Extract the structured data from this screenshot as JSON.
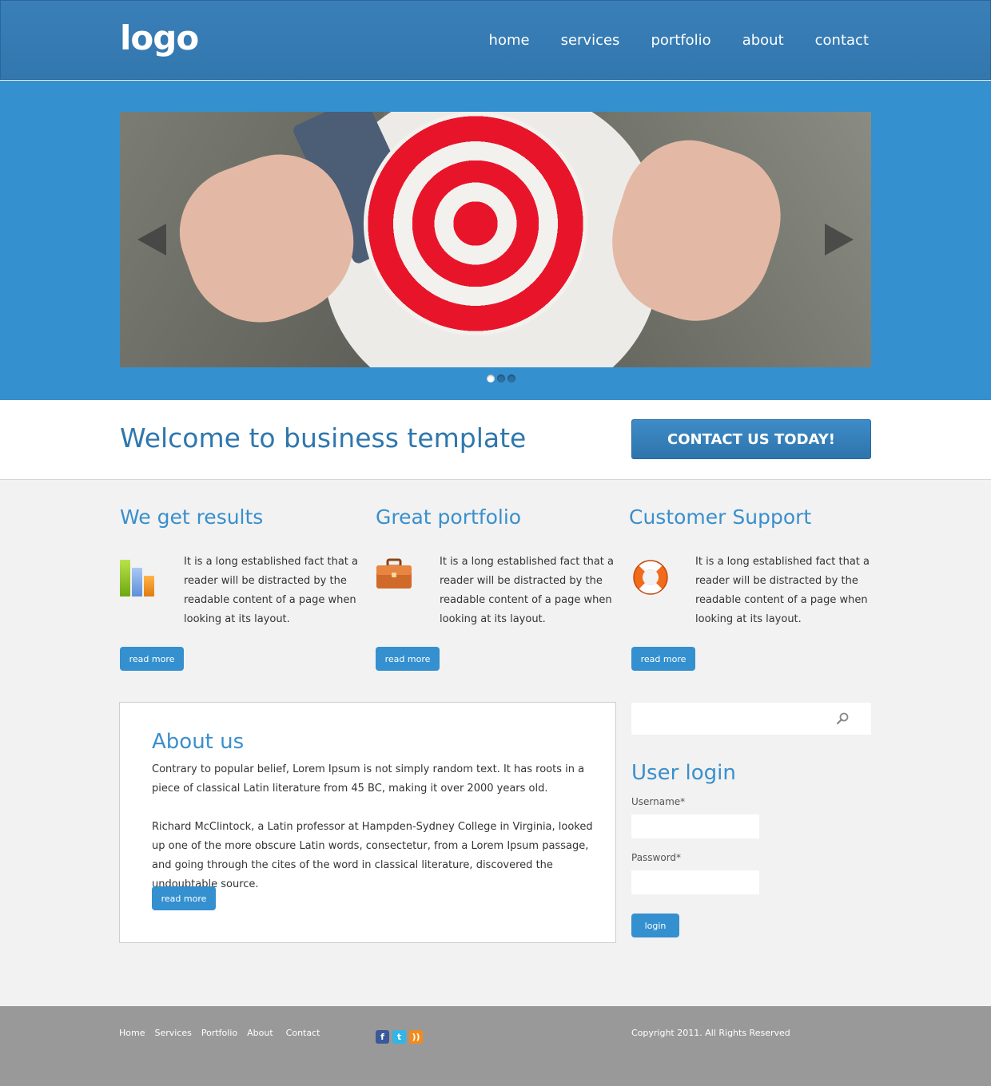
{
  "header": {
    "logo": "logo",
    "nav": [
      "home",
      "services",
      "portfolio",
      "about",
      "contact"
    ]
  },
  "slider": {
    "prev_icon": "chevron-left-icon",
    "next_icon": "chevron-right-icon",
    "slide_count": 3,
    "active_slide": 1
  },
  "welcome": {
    "title": "Welcome to business template",
    "cta_label": "CONTACT US TODAY!"
  },
  "features": [
    {
      "title": "We get results",
      "icon": "bar-chart-icon",
      "text": "It is a long established fact that a reader will be distracted by the readable content of a page when looking at its layout.",
      "button": "read more"
    },
    {
      "title": "Great portfolio",
      "icon": "briefcase-icon",
      "text": "It is a long established fact that a reader will be distracted by the readable content of a page when looking at its layout.",
      "button": "read more"
    },
    {
      "title": "Customer Support",
      "icon": "lifebuoy-icon",
      "text": "It is a long established fact that a reader will be distracted by the readable content of a page when looking at its layout.",
      "button": "read more"
    }
  ],
  "about": {
    "title": "About us",
    "paragraphs": [
      "Contrary to popular belief, Lorem Ipsum is not simply random text. It has roots in a piece of classical Latin literature from 45 BC, making it over 2000 years old.",
      "Richard McClintock, a Latin professor at Hampden-Sydney College in Virginia, looked up one of the more obscure Latin words, consectetur, from a Lorem Ipsum passage, and going through the cites of the word in classical literature, discovered the undoubtable source."
    ],
    "button": "read more"
  },
  "sidebar": {
    "search_value": "",
    "login_title": "User login",
    "username_label": "Username*",
    "password_label": "Password*",
    "username_value": "",
    "password_value": "",
    "login_button": "login"
  },
  "footer": {
    "nav": [
      "Home",
      "Services",
      "Portfolio",
      "About",
      "Contact"
    ],
    "social": [
      "facebook-icon",
      "twitter-icon",
      "rss-icon"
    ],
    "copyright": "Copyright 2011. All Rights Reserved"
  },
  "colors": {
    "brand_blue": "#3490cf",
    "header_blue": "#3277ae",
    "heading_blue": "#3a8fcc",
    "footer_gray": "#999999"
  }
}
